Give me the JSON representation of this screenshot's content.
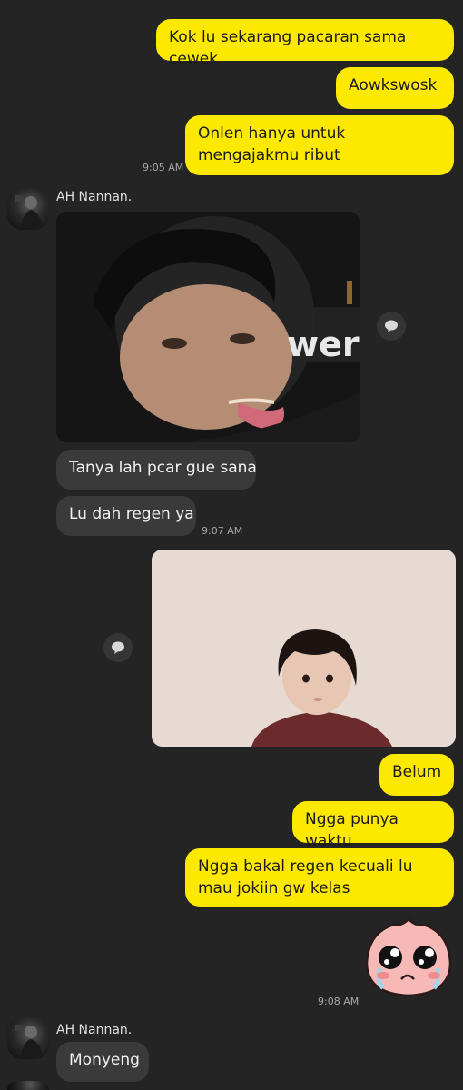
{
  "messages": {
    "m1": "Kok lu sekarang pacaran sama cewek",
    "m2": "Aowkswosk",
    "m3": "Onlen hanya untuk mengajakmu ribut",
    "t1": "9:05 AM",
    "sender1": "AH Nannan.",
    "photo1_text": "wer",
    "m4": "Tanya lah pcar gue sana",
    "m5": "Lu dah regen ya",
    "t2": "9:07 AM",
    "m6": "Belum",
    "m7": "Ngga punya waktu",
    "m8": "Ngga bakal regen kecuali lu mau jokiin gw kelas",
    "t3": "9:08 AM",
    "sender2": "AH Nannan.",
    "m9": "Monyeng"
  },
  "icons": {
    "reply": "speech-bubble-icon",
    "sticker": "crying-peach-sticker"
  },
  "colors": {
    "background": "#242424",
    "my_bubble": "#fde900",
    "their_bubble": "#3a3a3a"
  }
}
